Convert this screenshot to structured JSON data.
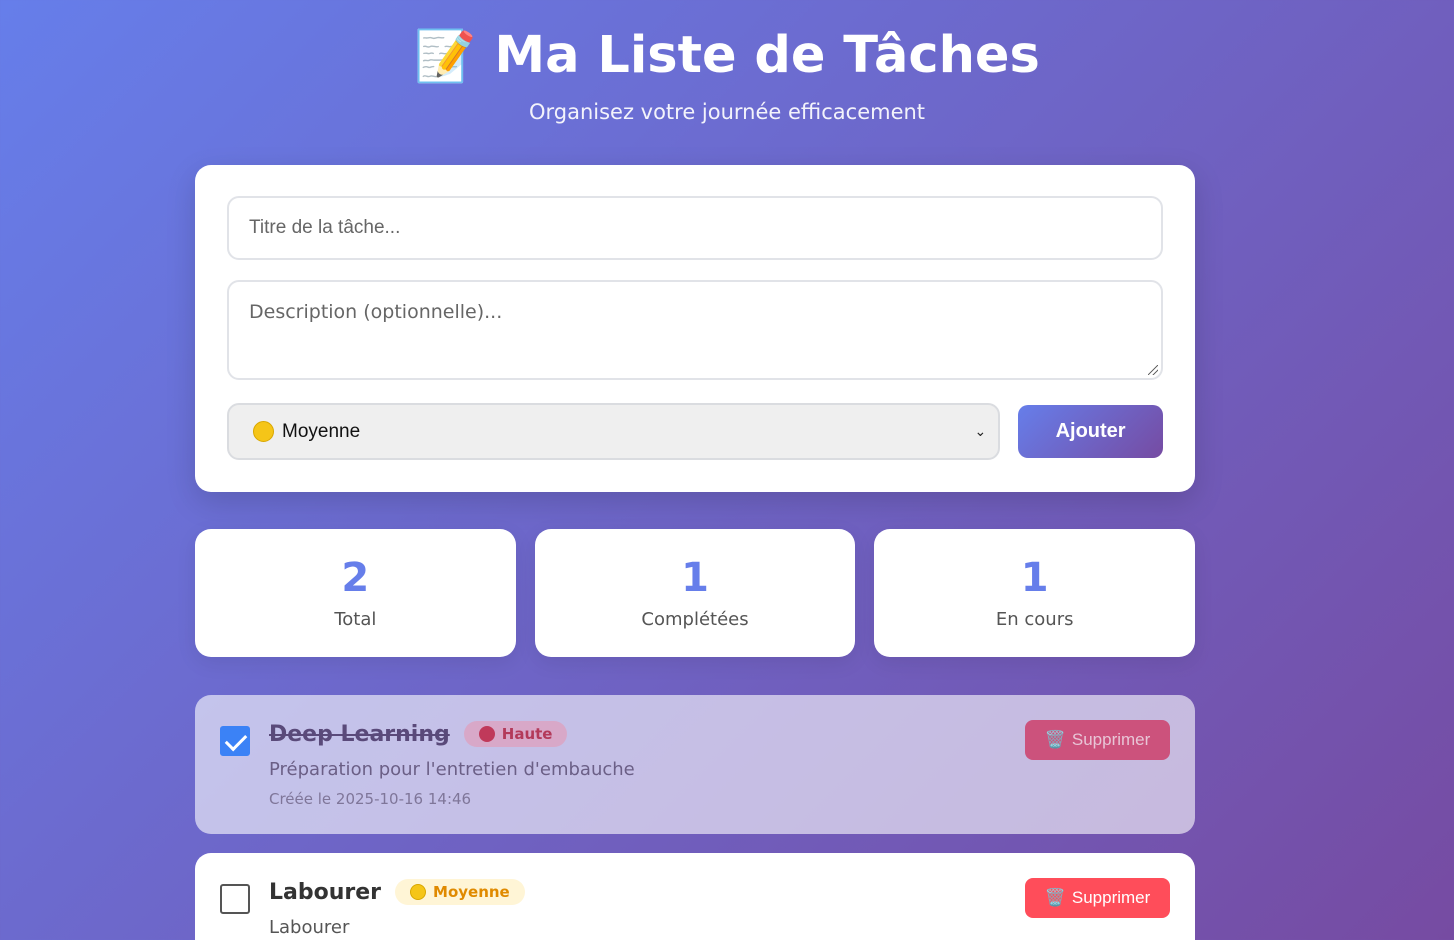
{
  "header": {
    "icon": "📝",
    "title": "Ma Liste de Tâches",
    "subtitle": "Organisez votre journée efficacement"
  },
  "form": {
    "title_placeholder": "Titre de la tâche...",
    "description_placeholder": "Description (optionnelle)...",
    "priority_selected": "Moyenne",
    "priority_color": "#f5c518",
    "add_label": "Ajouter"
  },
  "stats": [
    {
      "value": "2",
      "label": "Total"
    },
    {
      "value": "1",
      "label": "Complétées"
    },
    {
      "value": "1",
      "label": "En cours"
    }
  ],
  "tasks": [
    {
      "title": "Deep Learning",
      "priority": "Haute",
      "priority_color": "#c0395a",
      "description": "Préparation pour l'entretien d'embauche",
      "created": "Créée le 2025-10-16 14:46",
      "completed": true,
      "delete_label": "Supprimer",
      "delete_icon": "🗑️"
    },
    {
      "title": "Labourer",
      "priority": "Moyenne",
      "priority_color": "#f5c518",
      "description": "Labourer",
      "completed": false,
      "delete_label": "Supprimer",
      "delete_icon": "🗑️"
    }
  ]
}
